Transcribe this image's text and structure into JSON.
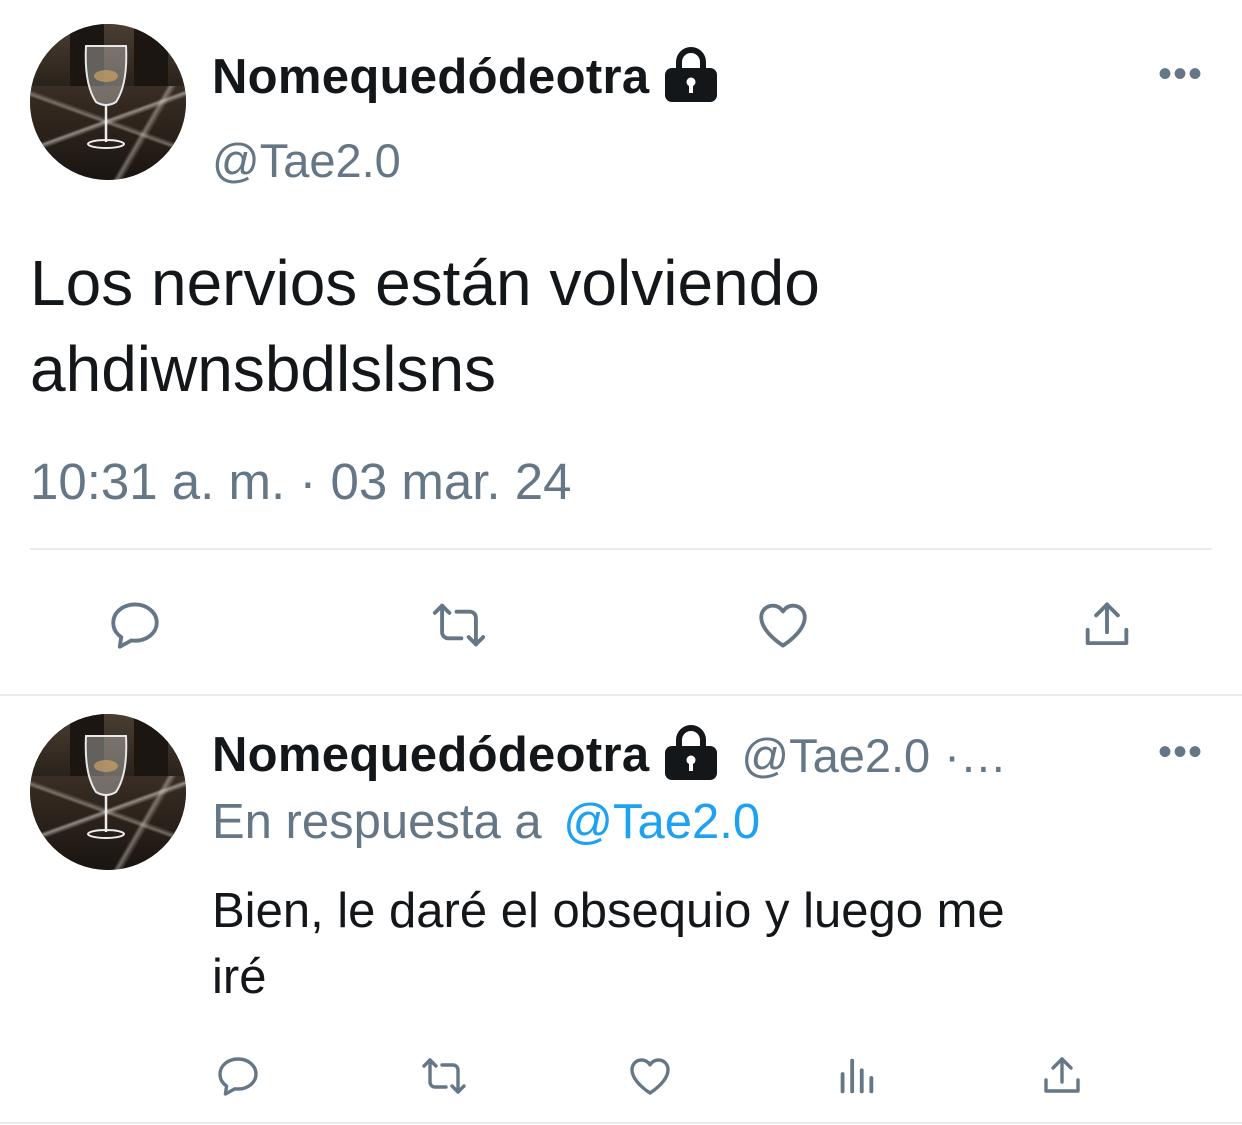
{
  "tweet": {
    "display_name": "Nomequedódeotra",
    "handle": "@Tae2.0",
    "text_line1": "Los nervios están volviendo",
    "text_line2": "ahdiwnsbdlslsns",
    "timestamp": "10:31 a. m. · 03 mar. 24",
    "icons": [
      "avatar",
      "lock-icon",
      "more-icon",
      "reply-icon",
      "retweet-icon",
      "like-icon",
      "share-icon"
    ]
  },
  "reply": {
    "display_name": "Nomequedódeotra",
    "handle": "@Tae2.0",
    "handle_trail": "·…",
    "reply_prefix": "En respuesta a",
    "reply_to": "@Tae2.0",
    "text_line1": "Bien, le daré el obsequio y luego me",
    "text_line2": "iré",
    "icons": [
      "avatar",
      "lock-icon",
      "more-icon",
      "reply-icon",
      "retweet-icon",
      "like-icon",
      "analytics-icon",
      "share-icon"
    ]
  },
  "colors": {
    "text": "#14171a",
    "secondary": "#657786",
    "link": "#1da1f2",
    "divider": "#e6ecf0"
  }
}
